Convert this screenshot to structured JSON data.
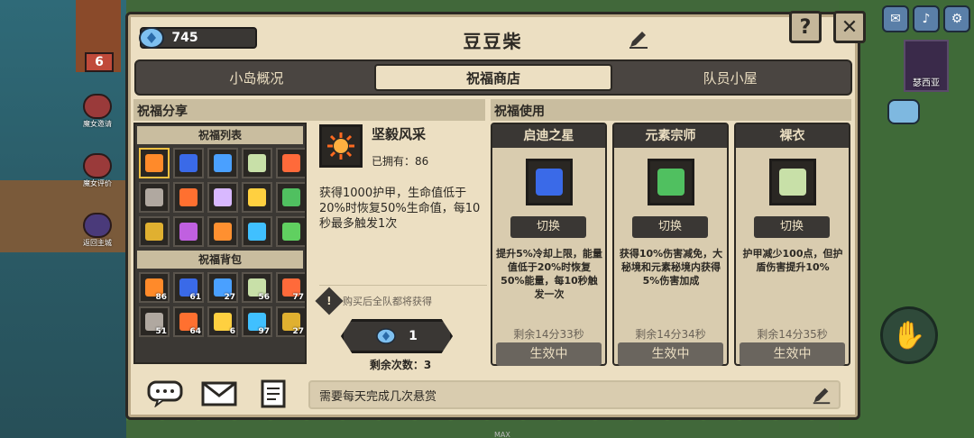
{
  "hud": {
    "left_badge": "6",
    "left_items": [
      {
        "label": "魔女邀请"
      },
      {
        "label": "魔女评价"
      },
      {
        "label": "返回主城"
      }
    ],
    "right_avatar_label": "瑟西亚",
    "bottom_max": "MAX"
  },
  "header": {
    "gems": "745",
    "title": "豆豆柴",
    "help": "?",
    "close": "✕"
  },
  "tabs": [
    {
      "label": "小岛概况",
      "active": false
    },
    {
      "label": "祝福商店",
      "active": true
    },
    {
      "label": "队员小屋",
      "active": false
    }
  ],
  "left_section": {
    "title": "祝福分享",
    "list_title": "祝福列表",
    "bag_title": "祝福背包",
    "list_icons": [
      {
        "color": "#ff8a2a"
      },
      {
        "color": "#3a6ae8"
      },
      {
        "color": "#4aa0ff"
      },
      {
        "color": "#c8e0a8"
      },
      {
        "color": "#ff6a3a"
      },
      {
        "color": "#b0a8a0"
      },
      {
        "color": "#ff7030"
      },
      {
        "color": "#d8b8ff"
      },
      {
        "color": "#ffd040"
      },
      {
        "color": "#50c060"
      },
      {
        "color": "#e0b030"
      },
      {
        "color": "#c060e0"
      },
      {
        "color": "#ff9030"
      },
      {
        "color": "#40c0ff"
      },
      {
        "color": "#60d060"
      }
    ],
    "bag_items": [
      {
        "color": "#ff8a2a",
        "count": "86"
      },
      {
        "color": "#3a6ae8",
        "count": "61"
      },
      {
        "color": "#4aa0ff",
        "count": "27"
      },
      {
        "color": "#c8e0a8",
        "count": "56"
      },
      {
        "color": "#ff6a3a",
        "count": "77"
      },
      {
        "color": "#b0a8a0",
        "count": "51"
      },
      {
        "color": "#ff7030",
        "count": "64"
      },
      {
        "color": "#ffd040",
        "count": "6"
      },
      {
        "color": "#40c0ff",
        "count": "97"
      },
      {
        "color": "#e0b030",
        "count": "27"
      }
    ],
    "detail": {
      "name": "坚毅风采",
      "owned": "已拥有：86",
      "desc": "获得1000护甲，生命值低于20%时恢复50%生命值，每10秒最多触发1次",
      "note": "购买后全队都将获得",
      "price": "1",
      "remaining": "剩余次数：3"
    }
  },
  "right_section": {
    "title": "祝福使用",
    "cards": [
      {
        "title": "启迪之星",
        "switch": "切换",
        "desc": "提升5%冷却上限，能量值低于20%时恢复50%能量，每10秒触发一次",
        "time": "剩余14分33秒",
        "status": "生效中",
        "color": "#3a6ae8"
      },
      {
        "title": "元素宗师",
        "switch": "切换",
        "desc": "获得10%伤害减免，大秘境和元素秘境内获得5%伤害加成",
        "time": "剩余14分34秒",
        "status": "生效中",
        "color": "#50c060"
      },
      {
        "title": "裸衣",
        "switch": "切换",
        "desc": "护甲减少100点，但护盾伤害提升10%",
        "time": "剩余14分35秒",
        "status": "生效中",
        "color": "#c8e0a8"
      }
    ]
  },
  "bottom": {
    "chat_text": "需要每天完成几次悬赏"
  }
}
